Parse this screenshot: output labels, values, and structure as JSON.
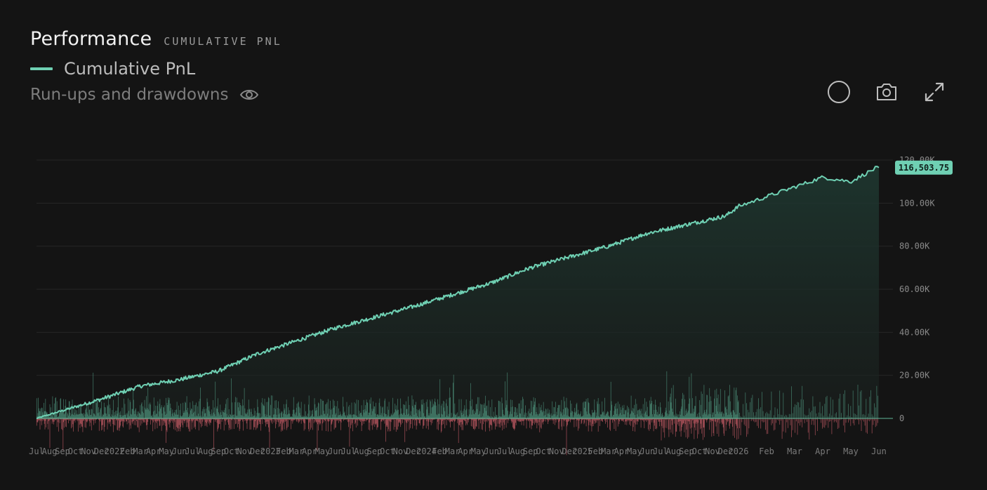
{
  "header": {
    "title": "Performance",
    "subtitle": "CUMULATIVE PNL",
    "legend_label": "Cumulative PnL",
    "runups_label": "Run-ups and drawdowns"
  },
  "toolbar": {
    "icons": [
      "circle-icon",
      "camera-icon",
      "expand-icon"
    ]
  },
  "colors": {
    "line": "#6fd0b3",
    "area_top": "#1f3a32",
    "positive_bar": "#5fb89a",
    "negative_bar": "#c05a63",
    "grid": "#262626",
    "last_label_bg": "#6fd0b3"
  },
  "chart_data": {
    "type": "area",
    "series": [
      {
        "name": "Cumulative PnL",
        "role": "line"
      }
    ],
    "y_ticks": [
      "120.00K",
      "100.00K",
      "80.00K",
      "60.00K",
      "40.00K",
      "20.00K",
      "0"
    ],
    "ylim": [
      -20000,
      120000
    ],
    "last_value": 116503.75,
    "last_value_label": "116,503.75",
    "x_ticks": [
      "Jul",
      "Aug",
      "Sep",
      "Oct",
      "Nov",
      "Dec",
      "2022",
      "Feb",
      "Mar",
      "Apr",
      "May",
      "Jun",
      "Jul",
      "Aug",
      "Sep",
      "Oct",
      "Nov",
      "Dec",
      "2023",
      "Feb",
      "Mar",
      "Apr",
      "May",
      "Jun",
      "Jul",
      "Aug",
      "Sep",
      "Oct",
      "Nov",
      "Dec",
      "2024",
      "Feb",
      "Mar",
      "Apr",
      "May",
      "Jun",
      "Jul",
      "Aug",
      "Sep",
      "Oct",
      "Nov",
      "Dec",
      "2025",
      "Feb",
      "Mar",
      "Apr",
      "May",
      "Jun",
      "Jul",
      "Aug",
      "Sep",
      "Oct",
      "Nov",
      "Dec",
      "2026",
      "Feb",
      "Mar",
      "Apr",
      "May",
      "Jun"
    ],
    "x_range": [
      "Jul 2021",
      "Jun 2026"
    ],
    "curve_waypoints": [
      [
        "Jul 2021",
        0
      ],
      [
        "Dec 2021",
        9000
      ],
      [
        "Mar 2022",
        15000
      ],
      [
        "Jun 2022",
        18000
      ],
      [
        "Sep 2022",
        22000
      ],
      [
        "Dec 2022",
        30000
      ],
      [
        "Jun 2023",
        42000
      ],
      [
        "Dec 2023",
        52000
      ],
      [
        "Jun 2024",
        63000
      ],
      [
        "Sep 2024",
        70000
      ],
      [
        "Dec 2024",
        75000
      ],
      [
        "Mar 2025",
        80000
      ],
      [
        "Jun 2025",
        86000
      ],
      [
        "Sep 2025",
        90000
      ],
      [
        "Dec 2025",
        94000
      ],
      [
        "Feb 2026",
        103000
      ],
      [
        "Apr 2026",
        112000
      ],
      [
        "May 2026",
        110000
      ],
      [
        "Jun 2026",
        117000
      ],
      [
        "Jun 2026",
        116503.75
      ]
    ],
    "bars": {
      "description": "Daily run-up (positive) and drawdown (negative) bars below the curve",
      "count": 1400,
      "positive_range": [
        0,
        28000
      ],
      "negative_range": [
        -20000,
        0
      ]
    },
    "grid": true,
    "legend": "top-left"
  }
}
